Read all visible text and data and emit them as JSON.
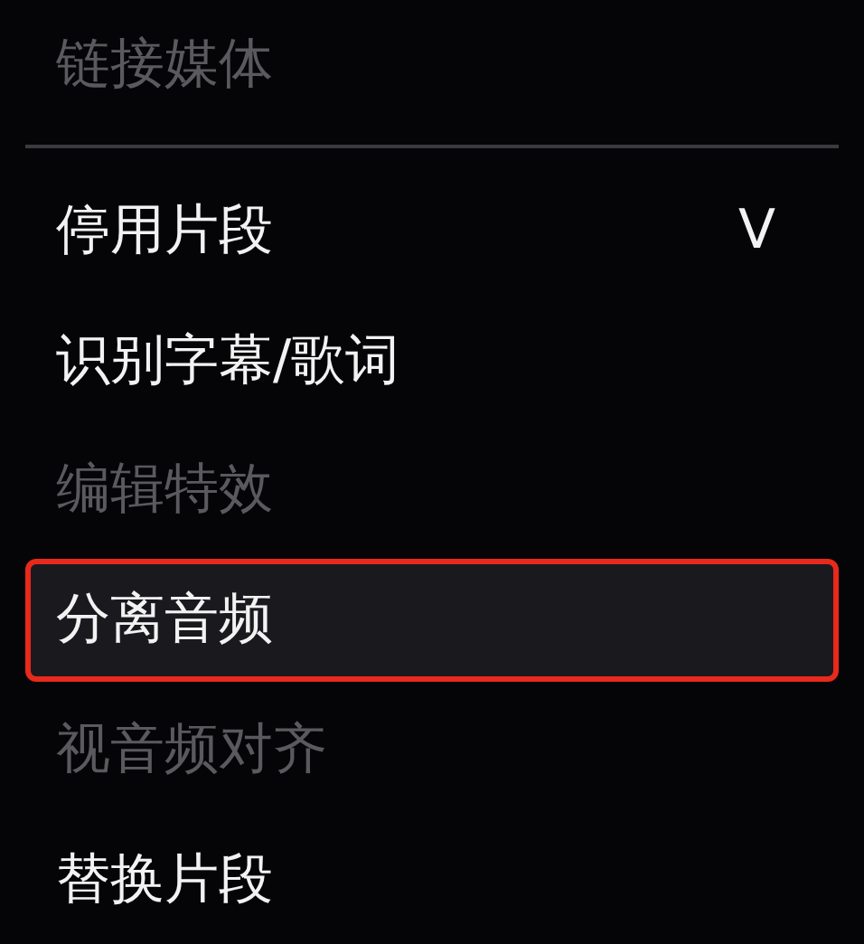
{
  "menu": {
    "items": [
      {
        "label": "链接媒体",
        "disabled": true,
        "selected": false
      },
      {
        "kind": "divider"
      },
      {
        "label": "停用片段",
        "shortcut": "V",
        "disabled": false,
        "selected": false
      },
      {
        "label": "识别字幕/歌词",
        "disabled": false,
        "selected": false
      },
      {
        "label": "编辑特效",
        "disabled": true,
        "selected": false
      },
      {
        "label": "分离音频",
        "disabled": false,
        "selected": true
      },
      {
        "label": "视音频对齐",
        "disabled": true,
        "selected": false
      },
      {
        "label": "替换片段",
        "disabled": false,
        "selected": false
      }
    ]
  }
}
